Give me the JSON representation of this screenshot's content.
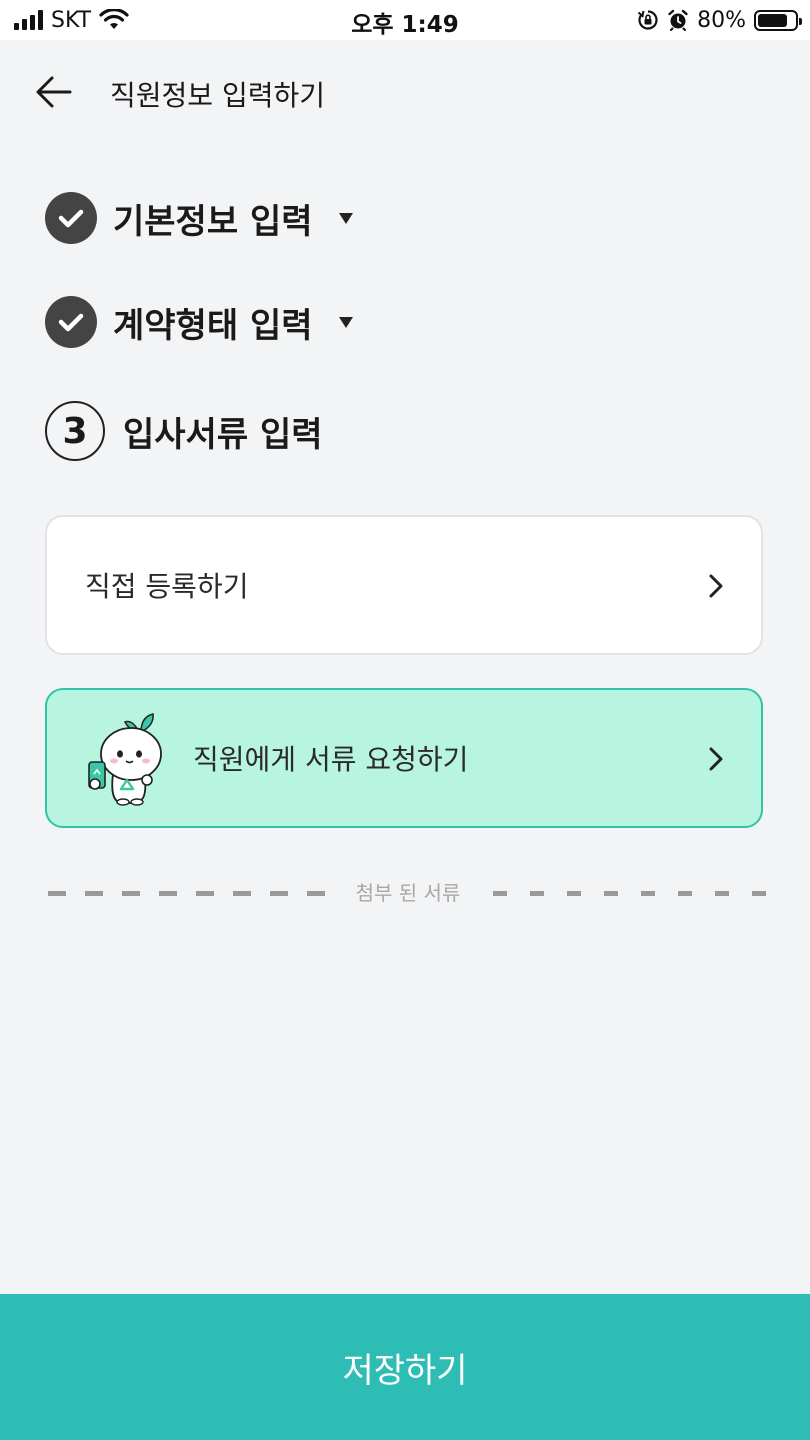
{
  "status_bar": {
    "carrier": "SKT",
    "time": "오후 1:49",
    "battery": "80%",
    "battery_level": 0.8,
    "icons": [
      "signal-icon",
      "wifi-icon",
      "orientation-lock-icon",
      "alarm-icon",
      "battery-icon"
    ]
  },
  "header": {
    "title": "직원정보 입력하기",
    "back_icon": "arrow-left-icon"
  },
  "steps": [
    {
      "state": "completed",
      "title": "기본정보 입력",
      "icon": "check-icon"
    },
    {
      "state": "completed",
      "title": "계약형태 입력",
      "icon": "check-icon"
    },
    {
      "state": "current",
      "number": "3",
      "title": "입사서류 입력"
    }
  ],
  "options": {
    "direct": {
      "label": "직접 등록하기",
      "icon": "chevron-right-icon"
    },
    "request": {
      "label": "직원에게 서류 요청하기",
      "icon": "chevron-right-icon",
      "illustration": "mascot-illustration"
    }
  },
  "attached_divider": {
    "label": "첨부 된 서류"
  },
  "footer": {
    "save_label": "저장하기"
  },
  "colors": {
    "primary": "#2dbdb4",
    "request_bg": "#b8f5e0",
    "request_border": "#33c3a5",
    "check_bg": "#444444",
    "page_bg": "#f3f4f6"
  }
}
